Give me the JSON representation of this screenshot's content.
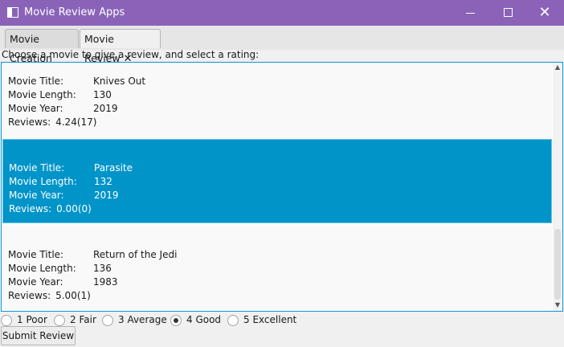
{
  "window": {
    "title": "Movie Review Apps",
    "controls": {
      "minimize": "minimize-icon",
      "maximize": "maximize-icon",
      "close": "✕"
    }
  },
  "tabs": [
    {
      "label": "Movie Creation",
      "active": false
    },
    {
      "label": "Movie Review",
      "active": true,
      "close": "✕"
    }
  ],
  "instruction": "Choose a movie to give a review, and select a rating:",
  "labels": {
    "title": "Movie Title:",
    "length": "Movie Length:",
    "year": "Movie Year:",
    "reviews": "Reviews:"
  },
  "movies": [
    {
      "title": "Knives Out",
      "length": "130",
      "year": "2019",
      "reviews": "4.24(17)",
      "selected": false
    },
    {
      "title": "Parasite",
      "length": "132",
      "year": "2019",
      "reviews": "0.00(0)",
      "selected": true
    },
    {
      "title": "Return of the Jedi",
      "length": "136",
      "year": "1983",
      "reviews": "5.00(1)",
      "selected": false
    }
  ],
  "ratings": [
    {
      "label": "1 Poor",
      "selected": false
    },
    {
      "label": "2 Fair",
      "selected": false
    },
    {
      "label": "3 Average",
      "selected": false
    },
    {
      "label": "4 Good",
      "selected": true
    },
    {
      "label": "5 Excellent",
      "selected": false
    }
  ],
  "submit_label": "Submit Review",
  "colors": {
    "titlebar": "#8a63b8",
    "selection": "#0094c9",
    "focus_border": "#0b96d6"
  }
}
